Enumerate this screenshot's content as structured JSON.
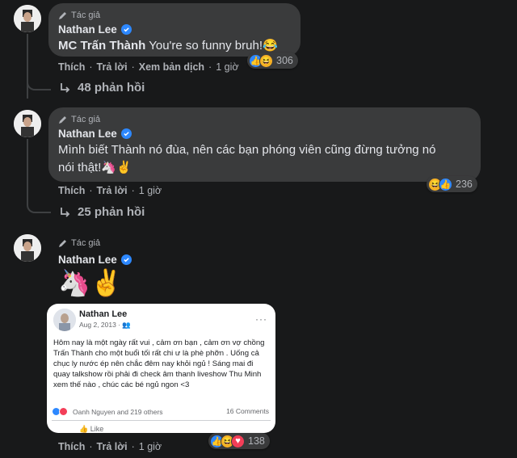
{
  "comments": [
    {
      "author_badge": "Tác giả",
      "name": "Nathan Lee",
      "mention": "MC Trấn Thành",
      "text": " You're so funny bruh!😂",
      "actions": {
        "like": "Thích",
        "reply": "Trả lời",
        "translate": "Xem bản dịch",
        "time": "1 giờ"
      },
      "reaction_count": "306",
      "replies_label": "48 phản hồi"
    },
    {
      "author_badge": "Tác giả",
      "name": "Nathan Lee",
      "text_line1": "Mình biết Thành nó đùa, nên các bạn phóng viên cũng đừng tưởng nó",
      "text_line2": "nói thật!🦄✌",
      "actions": {
        "like": "Thích",
        "reply": "Trả lời",
        "time": "1 giờ"
      },
      "reaction_count": "236",
      "replies_label": "25 phản hồi"
    },
    {
      "author_badge": "Tác giả",
      "name": "Nathan Lee",
      "emoji": "🦄✌",
      "actions": {
        "like": "Thích",
        "reply": "Trả lời",
        "time": "1 giờ"
      },
      "reaction_count": "138"
    }
  ],
  "screenshot": {
    "name": "Nathan Lee",
    "date": "Aug 2, 2013 · ",
    "dots": "···",
    "body": "Hôm nay là một ngày rất vui , cảm ơn bạn , cảm ơn vợ chồng Trấn Thành cho một buổi tối rất chi ư là phè phỡn . Uống cả chục ly nước ép nên chắc đêm nay khỏi ngủ ! Sáng mai đi quay talkshow rồi phải đi check âm thanh liveshow Thu Minh xem thế nào , chúc các bé ngủ ngon <3",
    "reactors": "Oanh Nguyen and 219 others",
    "comments": "16 Comments",
    "like": "Like"
  },
  "colors": {
    "background": "#18191a",
    "bubble": "#3a3b3c",
    "verified": "#2d88ff",
    "muted_text": "#b0b3b8"
  },
  "icons": [
    "pencil-icon",
    "verified-icon",
    "reply-arrow-icon",
    "like-reaction-icon",
    "haha-reaction-icon",
    "love-reaction-icon"
  ]
}
